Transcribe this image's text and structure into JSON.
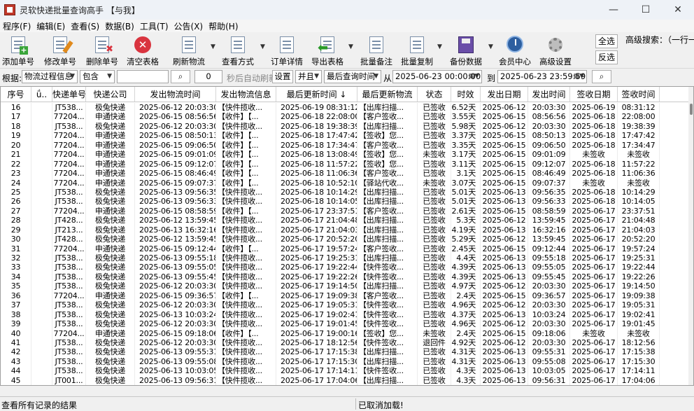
{
  "window": {
    "title": "灵软快递批量查询高手 【与我】",
    "controls": [
      "—",
      "☐",
      "✕"
    ]
  },
  "menu": [
    "程序(F)",
    "编辑(E)",
    "查看(S)",
    "数据(B)",
    "工具(T)",
    "公告(X)",
    "帮助(H)"
  ],
  "toolbar": {
    "add": "添加单号",
    "edit": "修改单号",
    "delete": "删除单号",
    "clear": "清空表格",
    "refresh": "刷新物流",
    "view": "查看方式",
    "detail": "订单详情",
    "export": "导出表格",
    "note": "批量备注",
    "copy": "批量复制",
    "backup": "备份数据",
    "member": "会员中心",
    "settings": "高级设置",
    "select_all": "全选",
    "invert": "反选",
    "adv_search": "高级搜索：（一行一"
  },
  "filter": {
    "root_label": "根据:",
    "field": "物流过程信息",
    "op": "包含",
    "keyword": "",
    "refresh_seconds": "0",
    "auto_label": "秒后自动刷新",
    "set_btn": "设置",
    "logic": "并且",
    "time_field": "最后查询时间",
    "from_label": "从",
    "from_date": "2025-06-23 00:00:00",
    "to_label": "到",
    "to_date": "2025-06-23 23:59:59"
  },
  "columns": [
    "序号",
    "ǘ..",
    "快递单号",
    "快递公司",
    "发出物流时间",
    "发出物流信息",
    "最后更新时间 ↓",
    "最后更新物流",
    "状态",
    "时效",
    "发出日期",
    "发出时间",
    "签收日期",
    "签收时间"
  ],
  "rows": [
    [
      "16",
      "",
      "JT538...",
      "极兔快递",
      "2025-06-12 20:03:30",
      "【快件揽收...",
      "2025-06-19 08:31:12",
      "【出库扫描...",
      "已签收",
      "6.52天",
      "2025-06-12",
      "20:03:30",
      "2025-06-19",
      "08:31:12"
    ],
    [
      "17",
      "",
      "77204...",
      "申通快递",
      "2025-06-15 08:56:56",
      "【收件】【...",
      "2025-06-18 22:08:00",
      "【客户签收...",
      "已签收",
      "3.55天",
      "2025-06-15",
      "08:56:56",
      "2025-06-18",
      "22:08:00"
    ],
    [
      "18",
      "",
      "JT538...",
      "极兔快递",
      "2025-06-12 20:03:30",
      "【快件揽收...",
      "2025-06-18 19:38:39",
      "【出库扫描...",
      "已签收",
      "5.98天",
      "2025-06-12",
      "20:03:30",
      "2025-06-18",
      "19:38:39"
    ],
    [
      "19",
      "",
      "77204...",
      "申通快递",
      "2025-06-15 08:50:13",
      "【收件】【...",
      "2025-06-18 17:47:42",
      "【签收】您...",
      "已签收",
      "3.37天",
      "2025-06-15",
      "08:50:13",
      "2025-06-18",
      "17:47:42"
    ],
    [
      "20",
      "",
      "77204...",
      "申通快递",
      "2025-06-15 09:06:50",
      "【收件】【...",
      "2025-06-18 17:34:47",
      "【客户签收...",
      "已签收",
      "3.35天",
      "2025-06-15",
      "09:06:50",
      "2025-06-18",
      "17:34:47"
    ],
    [
      "21",
      "",
      "77204...",
      "申通快递",
      "2025-06-15 09:01:09",
      "【收件】【...",
      "2025-06-18 13:08:49",
      "【签收】您...",
      "未签收",
      "3.17天",
      "2025-06-15",
      "09:01:09",
      "未签收",
      "未签收"
    ],
    [
      "22",
      "",
      "77204...",
      "申通快递",
      "2025-06-15 09:12:07",
      "【收件】【...",
      "2025-06-18 11:57:22",
      "【签收】您...",
      "已签收",
      "3.11天",
      "2025-06-15",
      "09:12:07",
      "2025-06-18",
      "11:57:22"
    ],
    [
      "23",
      "",
      "77204...",
      "申通快递",
      "2025-06-15 08:46:49",
      "【收件】【...",
      "2025-06-18 11:06:36",
      "【客户签收...",
      "已签收",
      "3.1天",
      "2025-06-15",
      "08:46:49",
      "2025-06-18",
      "11:06:36"
    ],
    [
      "24",
      "",
      "77204...",
      "申通快递",
      "2025-06-15 09:07:37",
      "【收件】【...",
      "2025-06-18 10:52:10",
      "【驿站代收...",
      "未签收",
      "3.07天",
      "2025-06-15",
      "09:07:37",
      "未签收",
      "未签收"
    ],
    [
      "25",
      "",
      "JT538...",
      "极兔快递",
      "2025-06-13 09:56:35",
      "【快件揽收...",
      "2025-06-18 10:14:29",
      "【出库扫描...",
      "已签收",
      "5.01天",
      "2025-06-13",
      "09:56:35",
      "2025-06-18",
      "10:14:29"
    ],
    [
      "26",
      "",
      "JT538...",
      "极兔快递",
      "2025-06-13 09:56:33",
      "【快件揽收...",
      "2025-06-18 10:14:05",
      "【出库扫描...",
      "已签收",
      "5.01天",
      "2025-06-13",
      "09:56:33",
      "2025-06-18",
      "10:14:05"
    ],
    [
      "27",
      "",
      "77204...",
      "申通快递",
      "2025-06-15 08:58:59",
      "【收件】【...",
      "2025-06-17 23:37:51",
      "【客户签收...",
      "已签收",
      "2.61天",
      "2025-06-15",
      "08:58:59",
      "2025-06-17",
      "23:37:51"
    ],
    [
      "28",
      "",
      "JT428...",
      "极兔快递",
      "2025-06-12 13:59:45",
      "【快件揽收...",
      "2025-06-17 21:04:48",
      "【出库扫描...",
      "已签收",
      "5.3天",
      "2025-06-12",
      "13:59:45",
      "2025-06-17",
      "21:04:48"
    ],
    [
      "29",
      "",
      "JT213...",
      "极兔快递",
      "2025-06-13 16:32:16",
      "【快件揽收...",
      "2025-06-17 21:04:03",
      "【出库扫描...",
      "已签收",
      "4.19天",
      "2025-06-13",
      "16:32:16",
      "2025-06-17",
      "21:04:03"
    ],
    [
      "30",
      "",
      "JT428...",
      "极兔快递",
      "2025-06-12 13:59:45",
      "【快件揽收...",
      "2025-06-17 20:52:20",
      "【出库扫描...",
      "已签收",
      "5.29天",
      "2025-06-12",
      "13:59:45",
      "2025-06-17",
      "20:52:20"
    ],
    [
      "31",
      "",
      "77204...",
      "申通快递",
      "2025-06-15 09:12:44",
      "【收件】【...",
      "2025-06-17 19:57:24",
      "【客户签收...",
      "已签收",
      "2.45天",
      "2025-06-15",
      "09:12:44",
      "2025-06-17",
      "19:57:24"
    ],
    [
      "32",
      "",
      "JT538...",
      "极兔快递",
      "2025-06-13 09:55:18",
      "【快件揽收...",
      "2025-06-17 19:25:31",
      "【出库扫描...",
      "已签收",
      "4.4天",
      "2025-06-13",
      "09:55:18",
      "2025-06-17",
      "19:25:31"
    ],
    [
      "33",
      "",
      "JT538...",
      "极兔快递",
      "2025-06-13 09:55:05",
      "【快件揽收...",
      "2025-06-17 19:22:44",
      "【快件签收...",
      "已签收",
      "4.39天",
      "2025-06-13",
      "09:55:05",
      "2025-06-17",
      "19:22:44"
    ],
    [
      "34",
      "",
      "JT538...",
      "极兔快递",
      "2025-06-13 09:55:45",
      "【快件揽收...",
      "2025-06-17 19:22:26",
      "【快件签收...",
      "已签收",
      "4.39天",
      "2025-06-13",
      "09:55:45",
      "2025-06-17",
      "19:22:26"
    ],
    [
      "35",
      "",
      "JT538...",
      "极兔快递",
      "2025-06-12 20:03:30",
      "【快件揽收...",
      "2025-06-17 19:14:50",
      "【出库扫描...",
      "已签收",
      "4.97天",
      "2025-06-12",
      "20:03:30",
      "2025-06-17",
      "19:14:50"
    ],
    [
      "36",
      "",
      "77204...",
      "申通快递",
      "2025-06-15 09:36:57",
      "【收件】【...",
      "2025-06-17 19:09:38",
      "【客户签收...",
      "已签收",
      "2.4天",
      "2025-06-15",
      "09:36:57",
      "2025-06-17",
      "19:09:38"
    ],
    [
      "37",
      "",
      "JT538...",
      "极兔快递",
      "2025-06-12 20:03:30",
      "【快件揽收...",
      "2025-06-17 19:05:31",
      "【快件签收...",
      "已签收",
      "4.96天",
      "2025-06-12",
      "20:03:30",
      "2025-06-17",
      "19:05:31"
    ],
    [
      "38",
      "",
      "JT538...",
      "极兔快递",
      "2025-06-13 10:03:24",
      "【快件揽收...",
      "2025-06-17 19:02:41",
      "【快件签收...",
      "已签收",
      "4.37天",
      "2025-06-13",
      "10:03:24",
      "2025-06-17",
      "19:02:41"
    ],
    [
      "39",
      "",
      "JT538...",
      "极兔快递",
      "2025-06-12 20:03:30",
      "【快件揽收...",
      "2025-06-17 19:01:45",
      "【快件签收...",
      "已签收",
      "4.96天",
      "2025-06-12",
      "20:03:30",
      "2025-06-17",
      "19:01:45"
    ],
    [
      "40",
      "",
      "77204...",
      "申通快递",
      "2025-06-15 09:18:06",
      "【收件】【...",
      "2025-06-17 19:00:16",
      "【签收】您...",
      "未签收",
      "2.4天",
      "2025-06-15",
      "09:18:06",
      "未签收",
      "未签收"
    ],
    [
      "41",
      "",
      "JT538...",
      "极兔快递",
      "2025-06-12 20:03:30",
      "【快件揽收...",
      "2025-06-17 18:12:56",
      "【快件签收...",
      "退回件",
      "4.92天",
      "2025-06-12",
      "20:03:30",
      "2025-06-17",
      "18:12:56"
    ],
    [
      "42",
      "",
      "JT538...",
      "极兔快递",
      "2025-06-13 09:55:31",
      "【快件揽收...",
      "2025-06-17 17:15:38",
      "【出库扫描...",
      "已签收",
      "4.31天",
      "2025-06-13",
      "09:55:31",
      "2025-06-17",
      "17:15:38"
    ],
    [
      "43",
      "",
      "JT538...",
      "极兔快递",
      "2025-06-13 09:55:08",
      "【快件揽收...",
      "2025-06-17 17:15:30",
      "【出库扫描...",
      "已签收",
      "4.31天",
      "2025-06-13",
      "09:55:08",
      "2025-06-17",
      "17:15:30"
    ],
    [
      "44",
      "",
      "JT538...",
      "极兔快递",
      "2025-06-13 10:03:05",
      "【快件揽收...",
      "2025-06-17 17:14:11",
      "【快件签收...",
      "已签收",
      "4.3天",
      "2025-06-13",
      "10:03:05",
      "2025-06-17",
      "17:14:11"
    ],
    [
      "45",
      "",
      "JT001...",
      "极兔快递",
      "2025-06-13 09:56:31",
      "【快件揽收...",
      "2025-06-17 17:04:06",
      "【出库扫描...",
      "已签收",
      "4.3天",
      "2025-06-13",
      "09:56:31",
      "2025-06-17",
      "17:04:06"
    ]
  ],
  "status": {
    "left": "查看所有记录的结果",
    "right": "已取消加载!"
  }
}
